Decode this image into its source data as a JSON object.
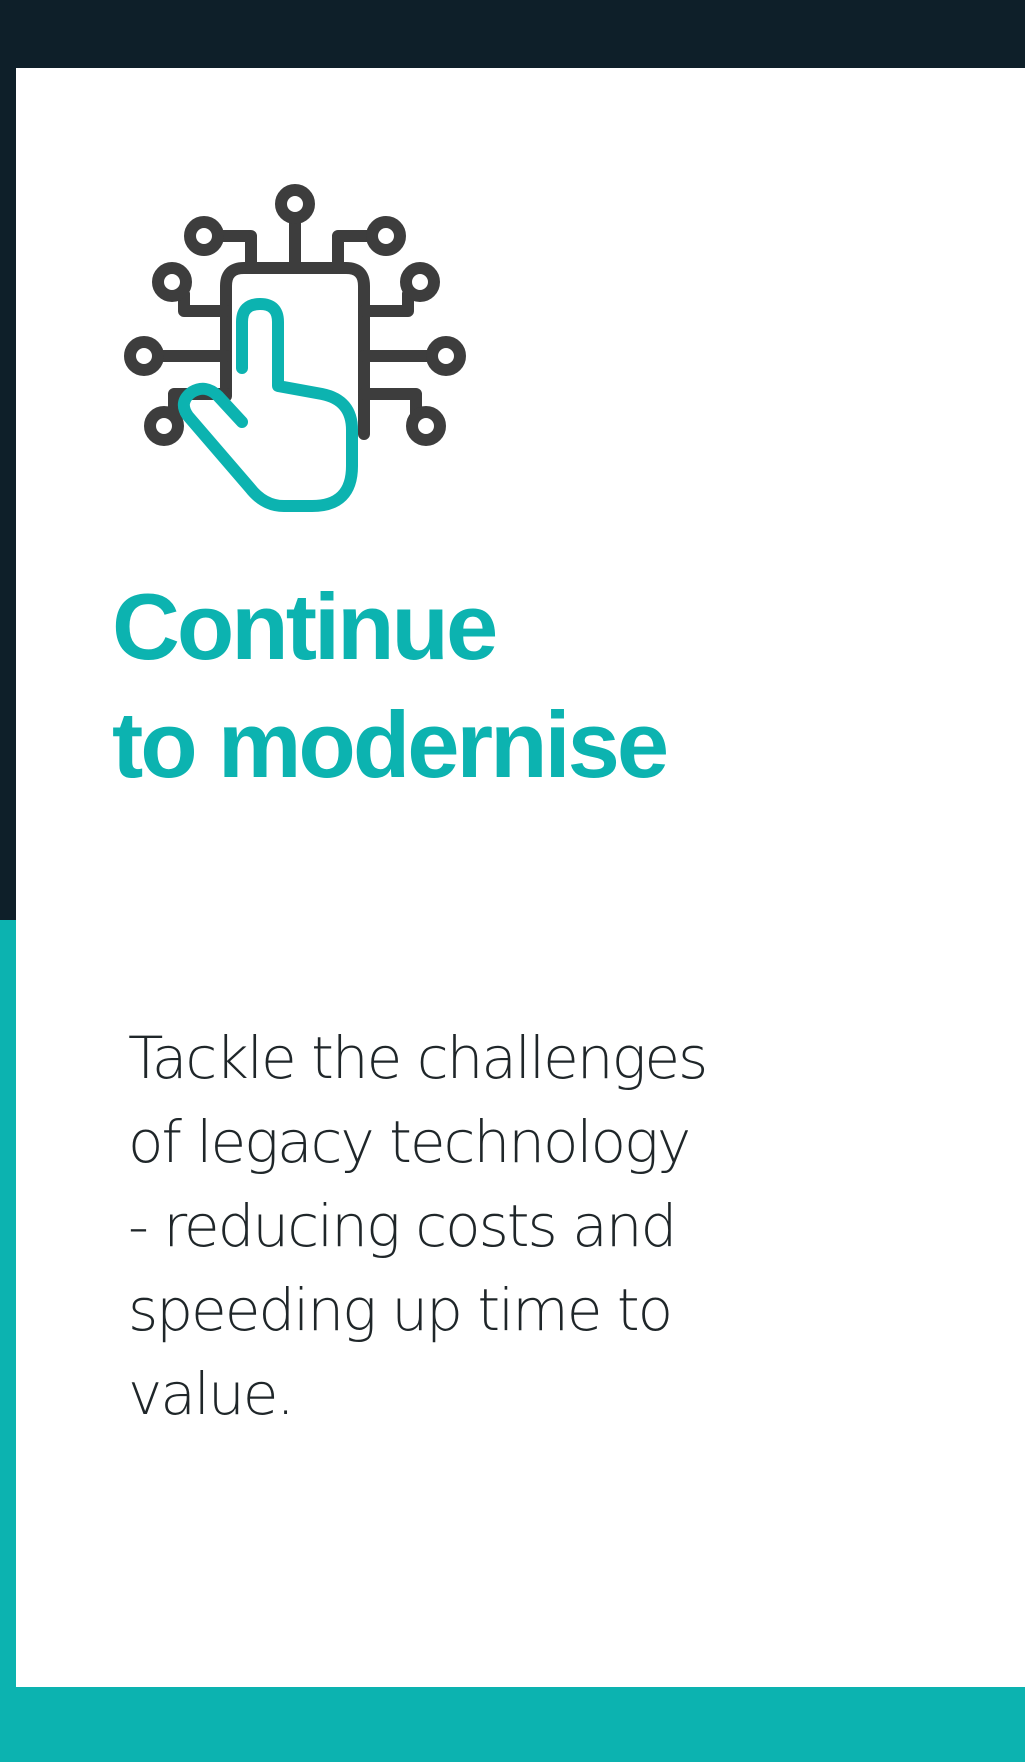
{
  "card": {
    "icon": "circuit-hand-pointer-icon",
    "title_lines": [
      "Continue",
      "to modernise"
    ],
    "body_lines": [
      "Tackle the challenges",
      "of legacy technology",
      "- reducing costs and",
      "speeding up time to",
      "value."
    ]
  },
  "colors": {
    "background_dark": "#0e1f29",
    "accent_teal": "#0cb3b0",
    "card_white": "#ffffff",
    "icon_grey": "#3d3d3d",
    "text_dark": "#1f2629"
  }
}
